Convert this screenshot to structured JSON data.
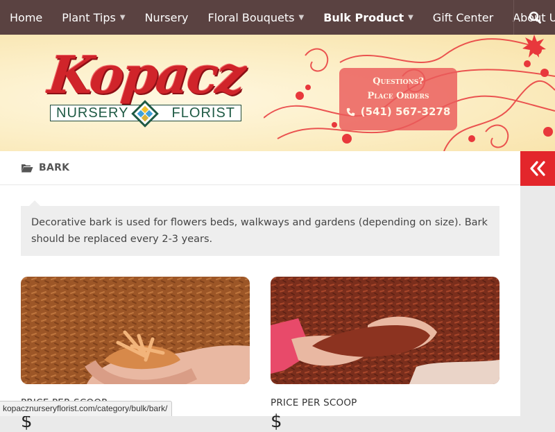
{
  "nav": {
    "items": [
      {
        "label": "Home",
        "dropdown": false
      },
      {
        "label": "Plant Tips",
        "dropdown": true
      },
      {
        "label": "Nursery",
        "dropdown": false
      },
      {
        "label": "Floral Bouquets",
        "dropdown": true
      },
      {
        "label": "Bulk Product",
        "dropdown": true
      },
      {
        "label": "Gift Center",
        "dropdown": false
      },
      {
        "label": "About Us",
        "dropdown": false
      }
    ],
    "active": "Bulk Product",
    "search_icon": "search-icon"
  },
  "header": {
    "logo_script": "Kopacz",
    "logo_left": "NURSERY",
    "logo_right": "FLORIST",
    "contact_line1": "Questions?",
    "contact_line2": "Place Orders",
    "phone": "(541) 567-3278"
  },
  "breadcrumb": {
    "icon": "folder-open-icon",
    "label": "BARK"
  },
  "description": "Decorative bark is used for flowers beds, walkways and gardens (depending on size). Bark should be replaced every 2-3 years.",
  "products": [
    {
      "title": "PRICE PER SCOOP",
      "price": "$",
      "image": "light-bark-chips"
    },
    {
      "title": "PRICE PER SCOOP",
      "price": "$",
      "image": "red-bark-mulch"
    }
  ],
  "sidebar_toggle_icon": "double-chevron-left-icon",
  "status_url": "kopacznurseryflorist.com/category/bulk/bark/",
  "colors": {
    "nav_bg": "#5a4241",
    "accent_red": "#e3262b",
    "header_bg": "#fcefc8",
    "contact_box": "#ea5a5a"
  }
}
